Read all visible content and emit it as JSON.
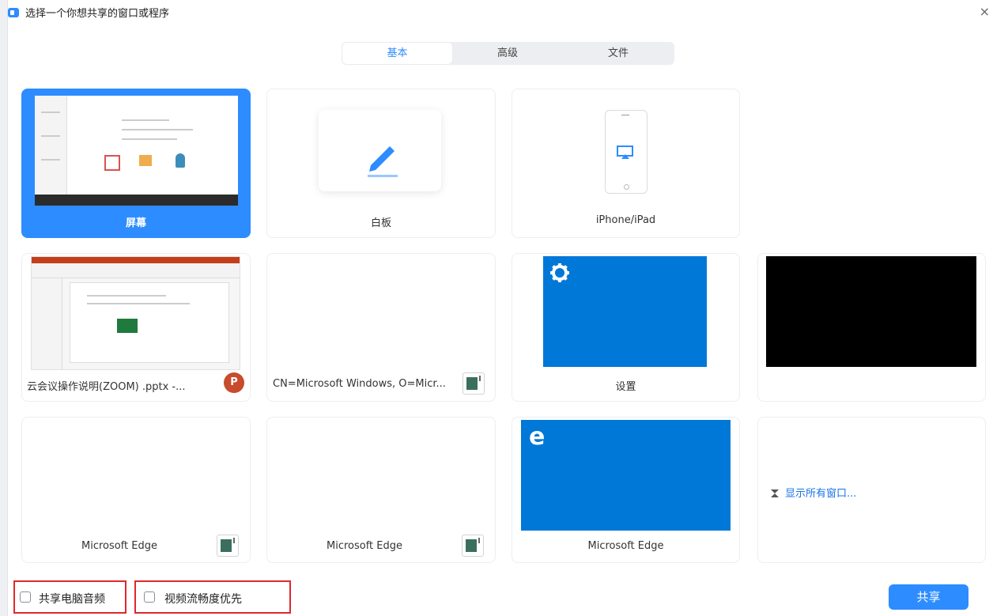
{
  "window": {
    "title": "选择一个你想共享的窗口或程序",
    "close_glyph": "×"
  },
  "tabs": [
    {
      "label": "基本",
      "active": true
    },
    {
      "label": "高级",
      "active": false
    },
    {
      "label": "文件",
      "active": false
    }
  ],
  "items": {
    "screen": {
      "label": "屏幕"
    },
    "whiteboard": {
      "label": "白板"
    },
    "iphone": {
      "label": "iPhone/iPad"
    },
    "ppt": {
      "label": "云会议操作说明(ZOOM) .pptx -...",
      "badge": "P"
    },
    "cn_window": {
      "label": "CN=Microsoft Windows, O=Micr..."
    },
    "settings": {
      "label": "设置"
    },
    "edge1": {
      "label": "Microsoft Edge"
    },
    "edge2": {
      "label": "Microsoft Edge"
    },
    "edge3": {
      "label": "Microsoft Edge",
      "letter": "e"
    },
    "show_all": {
      "label": "显示所有窗口..."
    }
  },
  "footer": {
    "share_audio": {
      "label": "共享电脑音频",
      "checked": false
    },
    "video_priority": {
      "label": "视频流畅度优先",
      "checked": false
    },
    "share_button": "共享"
  },
  "colors": {
    "accent": "#2d8cff",
    "tile_blue": "#0078d7",
    "highlight_red": "#e0282b"
  }
}
